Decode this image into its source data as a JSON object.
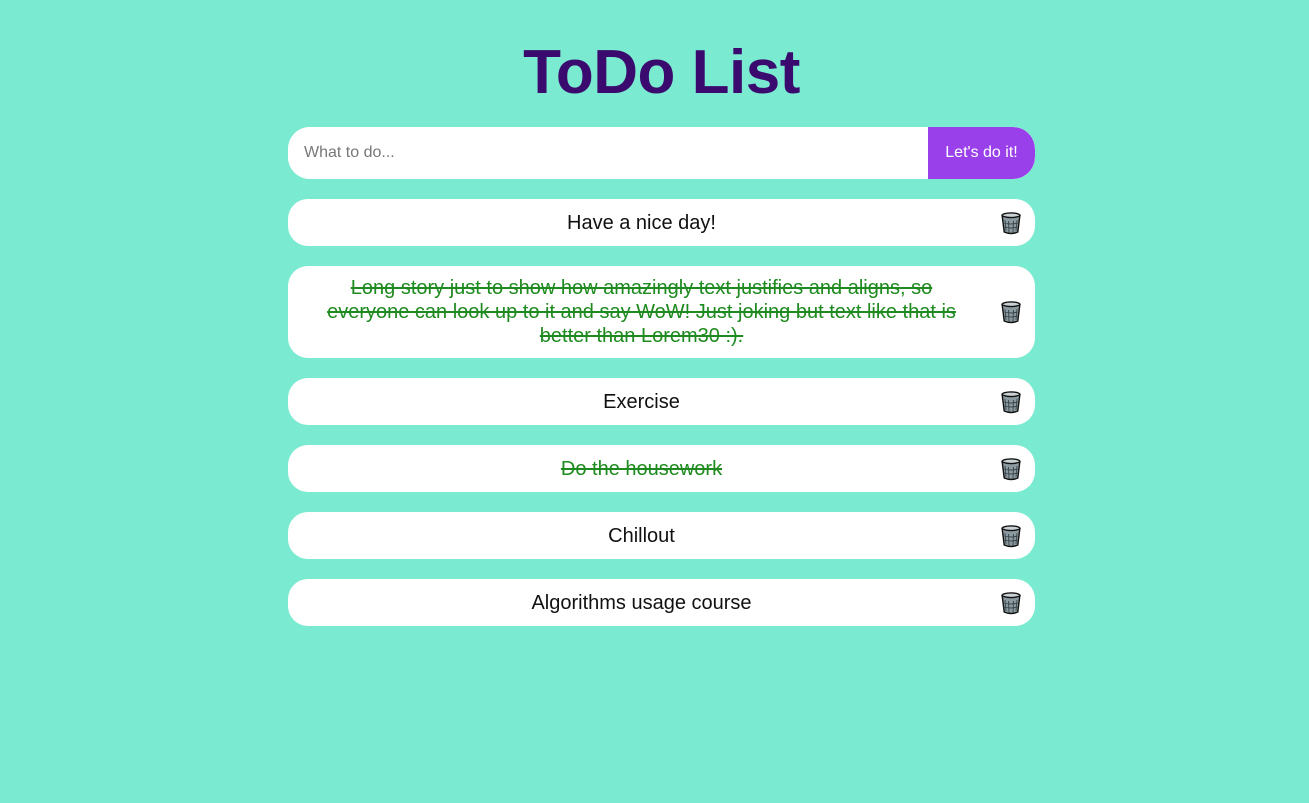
{
  "app": {
    "title": "ToDo List"
  },
  "input": {
    "placeholder": "What to do...",
    "value": ""
  },
  "add_button": {
    "label": "Let's do it!"
  },
  "todos": [
    {
      "text": "Have a nice day!",
      "done": false
    },
    {
      "text": "Long story just to show how amazingly text justifies and aligns, so everyone can look up to it and say WoW! Just joking but text like that is better than Lorem30 :).",
      "done": true
    },
    {
      "text": "Exercise",
      "done": false
    },
    {
      "text": "Do the housework",
      "done": true
    },
    {
      "text": "Chillout",
      "done": false
    },
    {
      "text": "Algorithms usage course",
      "done": false
    }
  ],
  "colors": {
    "background": "#7aead0",
    "title": "#3a0a6e",
    "button": "#9a40ea",
    "done_text": "#1f8a1f"
  },
  "icons": {
    "delete": "trash-icon"
  }
}
